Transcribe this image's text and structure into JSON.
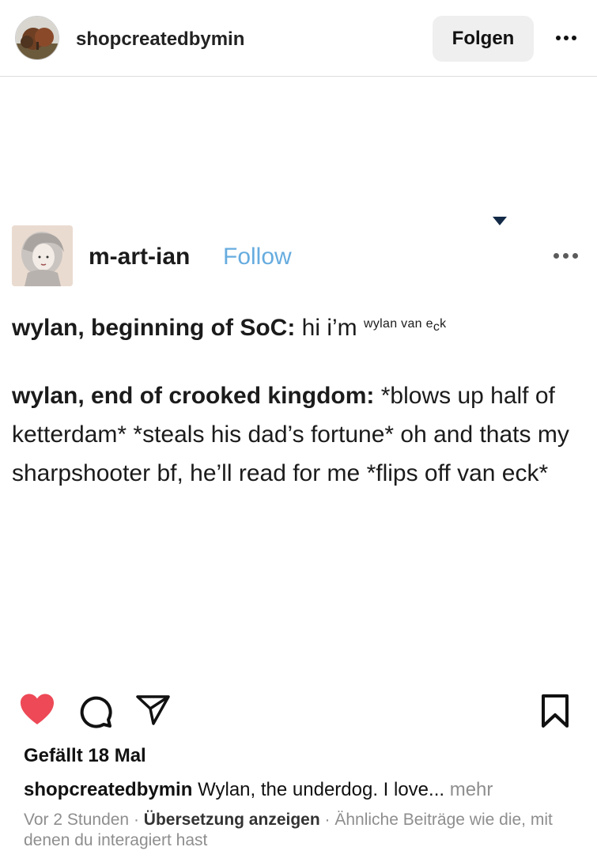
{
  "header": {
    "username": "shopcreatedbymin",
    "follow_label": "Folgen"
  },
  "post": {
    "author": "m-art-ian",
    "follow_label": "Follow",
    "line1_bold": "wylan, beginning of SoC:",
    "line1_text": "hi i’m",
    "line1_small_a": "wylan van e",
    "line1_small_b": "c",
    "line1_small_c": "k",
    "para_bold": "wylan, end of crooked kingdom:",
    "para_text": "*blows up half of ketterdam* *steals his dad’s fortune* oh and thats my sharpshooter bf, he’ll read for me *flips off van eck*"
  },
  "actions": {
    "like_color": "#ed4956",
    "icons": [
      "heart-icon",
      "comment-icon",
      "share-icon",
      "bookmark-icon"
    ]
  },
  "likes": "Gefällt 18 Mal",
  "caption": {
    "username": "shopcreatedbymin",
    "text": "Wylan, the underdog. I love...",
    "more": "mehr"
  },
  "meta": {
    "time": "Vor 2 Stunden",
    "separator": "·",
    "translate": "Übersetzung anzeigen",
    "suggested": "Ähnliche Beiträge wie die, mit denen du interagiert hast"
  }
}
